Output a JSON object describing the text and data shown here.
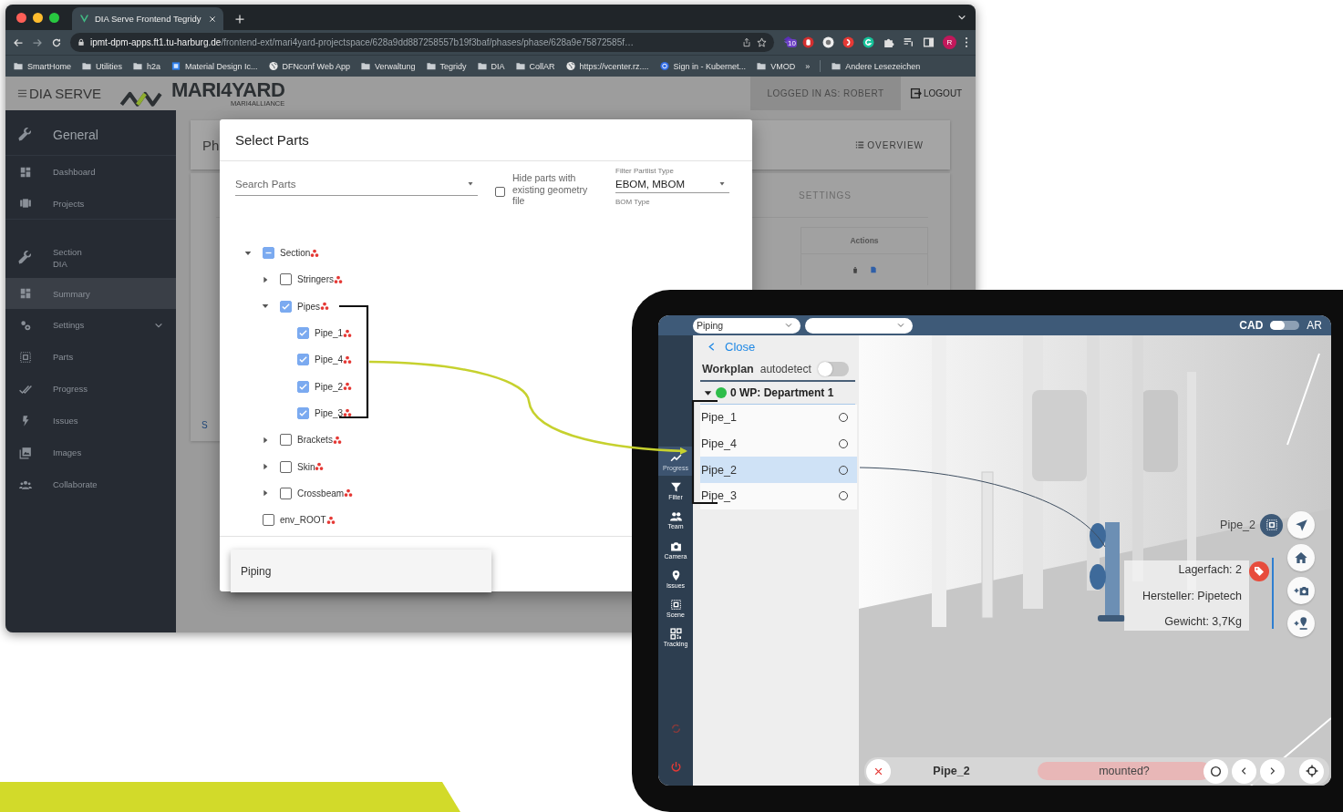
{
  "browser": {
    "tab": {
      "title": "DIA Serve Frontend Tegridy"
    },
    "address": {
      "host": "ipmt-dpm-apps.ft1.tu-harburg.de",
      "path": "/frontend-ext/mari4yard-projectspace/628a9dd887258557b19f3baf/phases/phase/628a9e75872585f…"
    },
    "extension_badge": "10",
    "profile": "R",
    "bookmarks": [
      {
        "kind": "folder",
        "label": "SmartHome"
      },
      {
        "kind": "folder",
        "label": "Utilities"
      },
      {
        "kind": "folder",
        "label": "h2a"
      },
      {
        "kind": "app",
        "label": "Material Design Ic..."
      },
      {
        "kind": "site",
        "label": "DFNconf Web App"
      },
      {
        "kind": "folder",
        "label": "Verwaltung"
      },
      {
        "kind": "folder",
        "label": "Tegridy"
      },
      {
        "kind": "folder",
        "label": "DIA"
      },
      {
        "kind": "folder",
        "label": "CollAR"
      },
      {
        "kind": "site",
        "label": "https://vcenter.rz...."
      },
      {
        "kind": "wheel",
        "label": "Sign in - Kubernet..."
      },
      {
        "kind": "folder",
        "label": "VMOD"
      },
      {
        "kind": "more",
        "label": "»"
      },
      {
        "kind": "folder",
        "label": "Andere Lesezeichen"
      }
    ]
  },
  "app": {
    "brand": "DIA SERVE",
    "logo": "MARI4YARD",
    "logo_subtitle": "MARI4ALLIANCE",
    "user": "LOGGED IN AS: ROBERT",
    "logout": "LOGOUT"
  },
  "sidebar": {
    "items": [
      {
        "kind": "header",
        "label": "General"
      },
      {
        "kind": "item",
        "label": "Dashboard",
        "selected": false
      },
      {
        "kind": "item",
        "label": "Projects",
        "selected": false
      },
      {
        "kind": "section",
        "label": "Section",
        "sublabel": "DIA"
      },
      {
        "kind": "item",
        "label": "Summary",
        "selected": true
      },
      {
        "kind": "item",
        "label": "Settings",
        "selected": false,
        "expanded": false
      },
      {
        "kind": "item",
        "label": "Parts",
        "selected": false
      },
      {
        "kind": "item",
        "label": "Progress",
        "selected": false
      },
      {
        "kind": "item",
        "label": "Issues",
        "selected": false
      },
      {
        "kind": "item",
        "label": "Images",
        "selected": false
      },
      {
        "kind": "item",
        "label": "Collaborate",
        "selected": false
      }
    ]
  },
  "background": {
    "title": "Ph",
    "overview": "OVERVIEW",
    "tab": "SETTINGS",
    "column": "Actions",
    "link": "S"
  },
  "dialog": {
    "title": "Select Parts",
    "search": {
      "placeholder": "Search Parts"
    },
    "hide_geometry": {
      "label": "Hide parts with existing geometry file",
      "checked": false
    },
    "filter": {
      "label": "Filter Partlist Type",
      "value": "EBOM, MBOM",
      "hint": "BOM Type"
    },
    "tree": [
      {
        "label": "Section",
        "checked": false,
        "partial": true,
        "expanded": true,
        "children": [
          {
            "label": "Stringers",
            "checked": false,
            "expanded": false
          },
          {
            "label": "Pipes",
            "checked": true,
            "expanded": true,
            "children": [
              {
                "label": "Pipe_1",
                "checked": true
              },
              {
                "label": "Pipe_4",
                "checked": true
              },
              {
                "label": "Pipe_2",
                "checked": true
              },
              {
                "label": "Pipe_3",
                "checked": true
              }
            ]
          },
          {
            "label": "Brackets",
            "checked": false,
            "expanded": false
          },
          {
            "label": "Skin",
            "checked": false,
            "expanded": false
          },
          {
            "label": "Crossbeam",
            "checked": false,
            "expanded": false
          }
        ]
      },
      {
        "label": "env_ROOT",
        "checked": false
      }
    ]
  },
  "menu": {
    "options": [
      {
        "label": "Piping"
      }
    ]
  },
  "tablet": {
    "select": {
      "value": "Piping"
    },
    "view_toggle": {
      "left": "CAD",
      "right": "AR",
      "on": false
    },
    "rail": [
      {
        "label": "Progress",
        "selected": true
      },
      {
        "label": "Filter",
        "selected": false
      },
      {
        "label": "Team",
        "selected": false
      },
      {
        "label": "Camera",
        "selected": false
      },
      {
        "label": "Issues",
        "selected": false
      },
      {
        "label": "Scene",
        "selected": false
      },
      {
        "label": "Tracking",
        "selected": false
      }
    ],
    "panel": {
      "back": "Close",
      "title": "Workplan",
      "autodetect": {
        "label": "autodetect",
        "on": false
      },
      "group": {
        "label": "0 WP: Department 1",
        "expanded": true,
        "items": [
          {
            "label": "Pipe_1",
            "selected": false,
            "checked": false
          },
          {
            "label": "Pipe_4",
            "selected": false,
            "checked": false
          },
          {
            "label": "Pipe_2",
            "selected": true,
            "checked": false
          },
          {
            "label": "Pipe_3",
            "selected": false,
            "checked": false
          }
        ]
      }
    },
    "viewport": {
      "part_label": "Pipe_2",
      "info": [
        "Lagerfach: 2",
        "Hersteller: Pipetech",
        "Gewicht: 3,7Kg"
      ],
      "bottom": {
        "part": "Pipe_2",
        "question": "mounted?"
      }
    }
  }
}
